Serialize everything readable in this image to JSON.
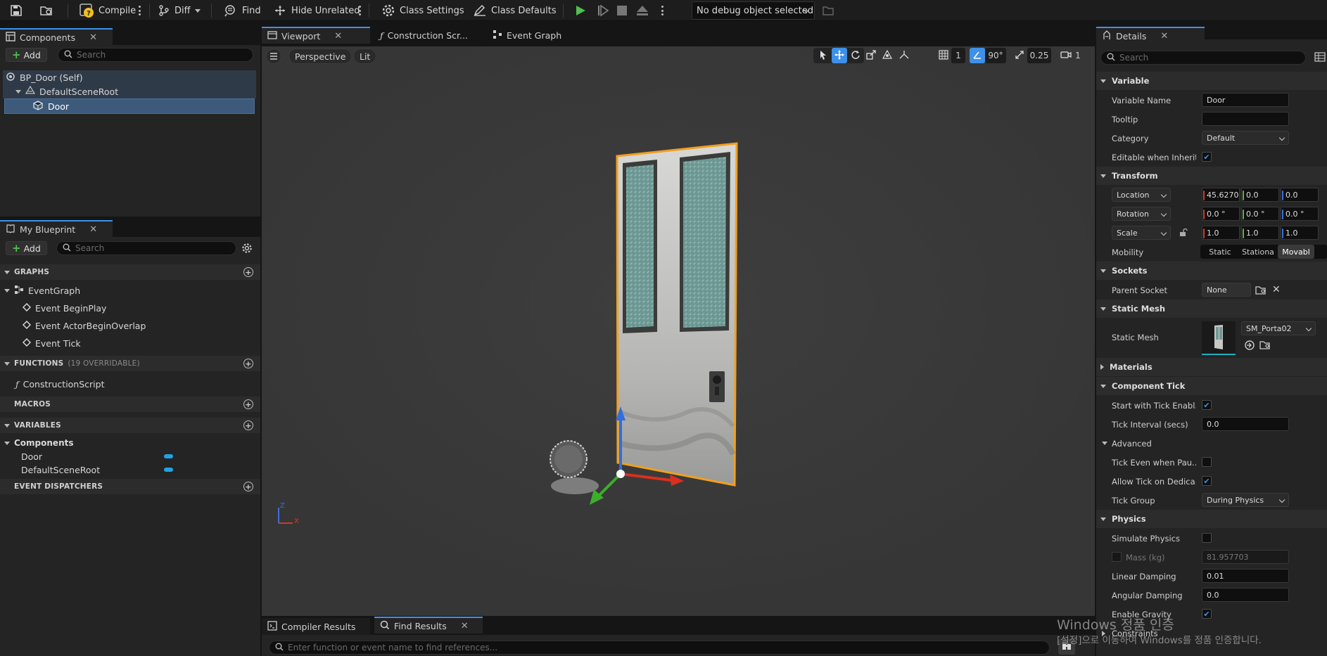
{
  "toolbar": {
    "compile": "Compile",
    "diff": "Diff",
    "find": "Find",
    "hide_unrelated": "Hide Unrelated",
    "class_settings": "Class Settings",
    "class_defaults": "Class Defaults",
    "debug_object": "No debug object selected"
  },
  "components_panel": {
    "tab": "Components",
    "add": "Add",
    "search_placeholder": "Search",
    "tree": [
      "BP_Door (Self)",
      "DefaultSceneRoot",
      "Door"
    ]
  },
  "my_blueprint": {
    "tab": "My Blueprint",
    "add": "Add",
    "search_placeholder": "Search",
    "graphs_label": "GRAPHS",
    "event_graph": "EventGraph",
    "events": [
      "Event BeginPlay",
      "Event ActorBeginOverlap",
      "Event Tick"
    ],
    "functions_label": "FUNCTIONS",
    "functions_count": "(19 OVERRIDABLE)",
    "construction_script": "ConstructionScript",
    "macros_label": "MACROS",
    "variables_label": "VARIABLES",
    "components_category": "Components",
    "variables": [
      "Door",
      "DefaultSceneRoot"
    ],
    "event_dispatchers_label": "EVENT DISPATCHERS"
  },
  "editor_tabs": [
    "Viewport",
    "Construction Scr...",
    "Event Graph"
  ],
  "viewport": {
    "perspective": "Perspective",
    "lit": "Lit",
    "grid_value": "1",
    "angle_value": "90°",
    "scale_value": "0.25",
    "camera_value": "1",
    "axis_z": "Z",
    "axis_x": "X"
  },
  "bottom": {
    "tab_compiler": "Compiler Results",
    "tab_find": "Find Results",
    "find_placeholder": "Enter function or event name to find references..."
  },
  "details": {
    "tab": "Details",
    "search_placeholder": "Search",
    "variable_section": "Variable",
    "variable_name_label": "Variable Name",
    "variable_name_value": "Door",
    "tooltip_label": "Tooltip",
    "category_label": "Category",
    "category_value": "Default",
    "editable_label": "Editable when Inherit...",
    "transform_section": "Transform",
    "location_label": "Location",
    "location": [
      "45.6270",
      "0.0",
      "0.0"
    ],
    "rotation_label": "Rotation",
    "rotation": [
      "0.0 °",
      "0.0 °",
      "0.0 °"
    ],
    "scale_label": "Scale",
    "scale": [
      "1.0",
      "1.0",
      "1.0"
    ],
    "mobility_label": "Mobility",
    "mobility_options": [
      "Static",
      "Stationa",
      "Movabl"
    ],
    "sockets_section": "Sockets",
    "parent_socket_label": "Parent Socket",
    "parent_socket_value": "None",
    "static_mesh_section": "Static Mesh",
    "static_mesh_label": "Static Mesh",
    "static_mesh_value": "SM_Porta02",
    "materials_section": "Materials",
    "component_tick_section": "Component Tick",
    "start_tick_label": "Start with Tick Enabl...",
    "tick_interval_label": "Tick Interval (secs)",
    "tick_interval_value": "0.0",
    "advanced_label": "Advanced",
    "tick_even_label": "Tick Even when Pau...",
    "allow_tick_label": "Allow Tick on Dedica...",
    "tick_group_label": "Tick Group",
    "tick_group_value": "During Physics",
    "physics_section": "Physics",
    "simulate_label": "Simulate Physics",
    "mass_label": "Mass (kg)",
    "mass_value": "81.957703",
    "linear_damping_label": "Linear Damping",
    "linear_damping_value": "0.01",
    "angular_damping_label": "Angular Damping",
    "angular_damping_value": "0.0",
    "enable_gravity_label": "Enable Gravity",
    "constraints_label": "Constraints"
  },
  "watermark": {
    "line1": "Windows 정품 인증",
    "line2": "[설정]으로 이동하여 Windows를 정품 인증합니다."
  },
  "colors": {
    "accent_blue": "#3e90e8",
    "selection": "#3d5a7a",
    "play_green": "#4fc04f",
    "variable_pill": "#1fa3e8",
    "door_outline": "#f0a020"
  }
}
